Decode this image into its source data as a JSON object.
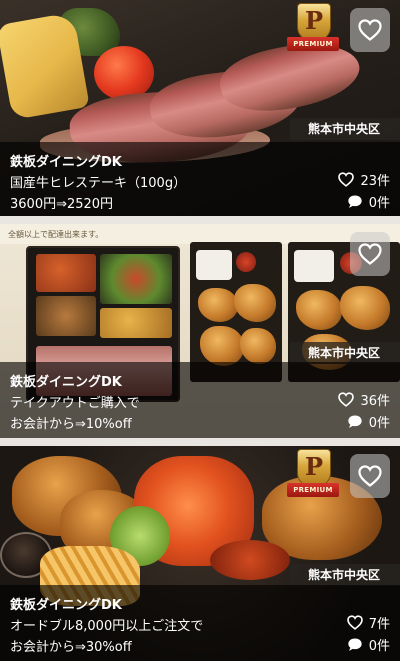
{
  "cards": [
    {
      "premium_badge": {
        "letter": "P",
        "label": "PREMIUM"
      },
      "area": "熊本市中央区",
      "shop": "鉄板ダイニングDK",
      "line1": "国産牛ヒレステーキ（100g）",
      "line2": "3600円⇒2520円",
      "likes": "23件",
      "comments": "0件"
    },
    {
      "header_note": "全額以上で配達出来ます。",
      "area": "熊本市中央区",
      "shop": "鉄板ダイニングDK",
      "line1": "テイクアウトご購入で",
      "line2": "お会計から⇒10%off",
      "likes": "36件",
      "comments": "0件"
    },
    {
      "premium_badge": {
        "letter": "P",
        "label": "PREMIUM"
      },
      "area": "熊本市中央区",
      "shop": "鉄板ダイニングDK",
      "line1": "オードブル8,000円以上ご注文で",
      "line2": "お会計から⇒30%off",
      "likes": "7件",
      "comments": "0件"
    }
  ],
  "icons": {
    "favorite": "heart-outline-icon",
    "likes": "heart-outline-icon",
    "comments": "speech-bubble-icon"
  },
  "colors": {
    "overlay": "#000000",
    "premium_gold": "#d7a63b",
    "premium_red": "#c4241c"
  }
}
